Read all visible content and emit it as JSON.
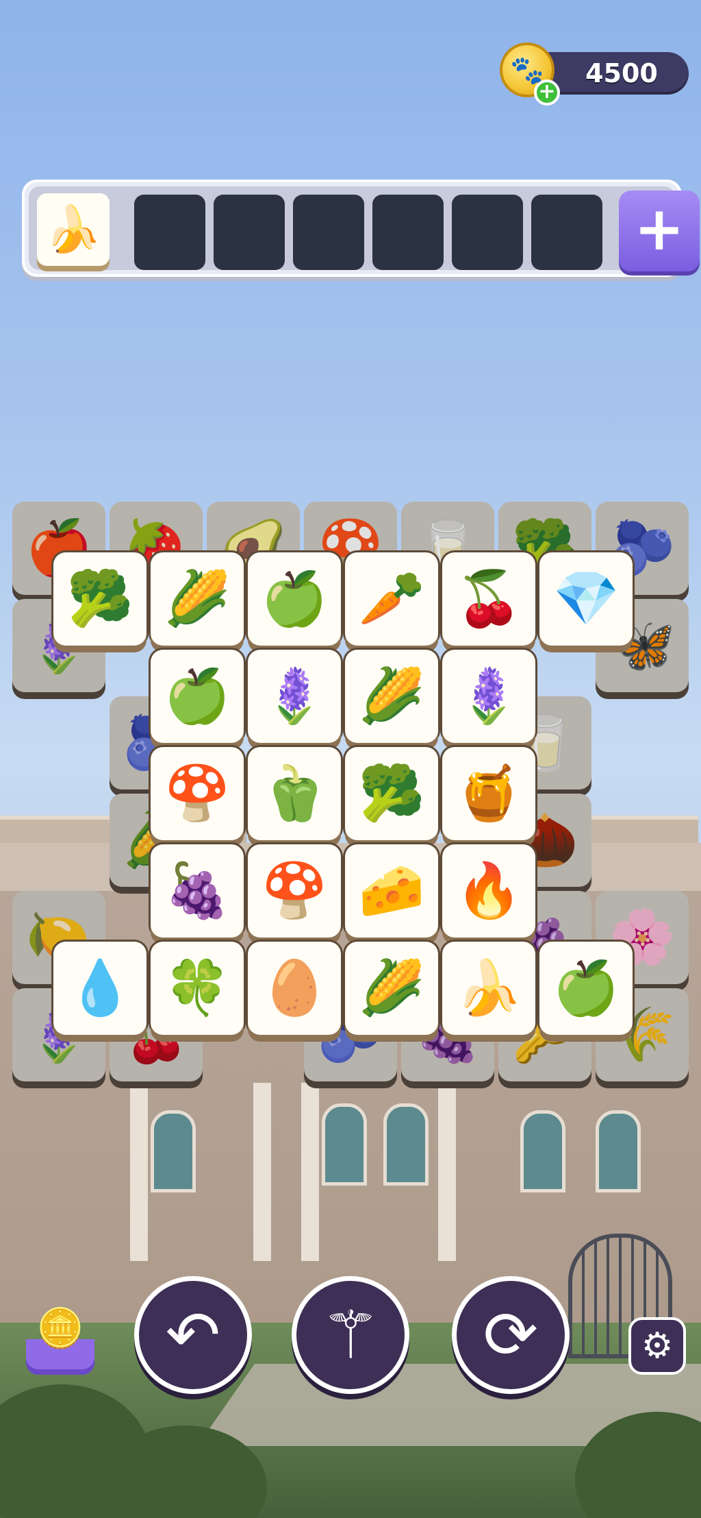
{
  "header": {
    "coins": "4500",
    "coin_icon": "paw-coin-icon",
    "add_coins_icon": "plus-icon"
  },
  "tray": {
    "slot_count": 7,
    "filled": [
      "🍌"
    ],
    "add_slot_icon": "plus-icon"
  },
  "board": {
    "under_tiles": [
      "🍎",
      "🍓",
      "🥑",
      "🍄",
      "🥛",
      "🥦",
      "🫐",
      "🪻",
      "🦋",
      "🫐",
      "🥛",
      "🌽",
      "🌰",
      "🍋",
      "🍇",
      "🌸",
      "🪻",
      "🍒",
      "🫐",
      "🍇",
      "🔑",
      "🌾"
    ],
    "rows": [
      [
        "🥦",
        "🌽",
        "🍏",
        "🥕",
        "🍒",
        "💎"
      ],
      [
        "🍏",
        "🪻",
        "🌽",
        "🪻"
      ],
      [
        "🍄",
        "🫑",
        "🥦",
        "🍯"
      ],
      [
        "🍇",
        "🍄",
        "🧀",
        "🔥"
      ],
      [
        "💧",
        "🍀",
        "🥚",
        "🌽",
        "🍌",
        "🍏"
      ]
    ]
  },
  "tools": {
    "undo_icon": "undo-arrow-icon",
    "magic_icon": "magic-wand-icon",
    "shuffle_icon": "shuffle-icon",
    "coin_pile_icon": "coin-pile-icon",
    "settings_icon": "gear-icon"
  },
  "colors": {
    "panel": "#3d2f55",
    "accent": "#7a5ee0",
    "tile_face": "#fffdf6"
  }
}
